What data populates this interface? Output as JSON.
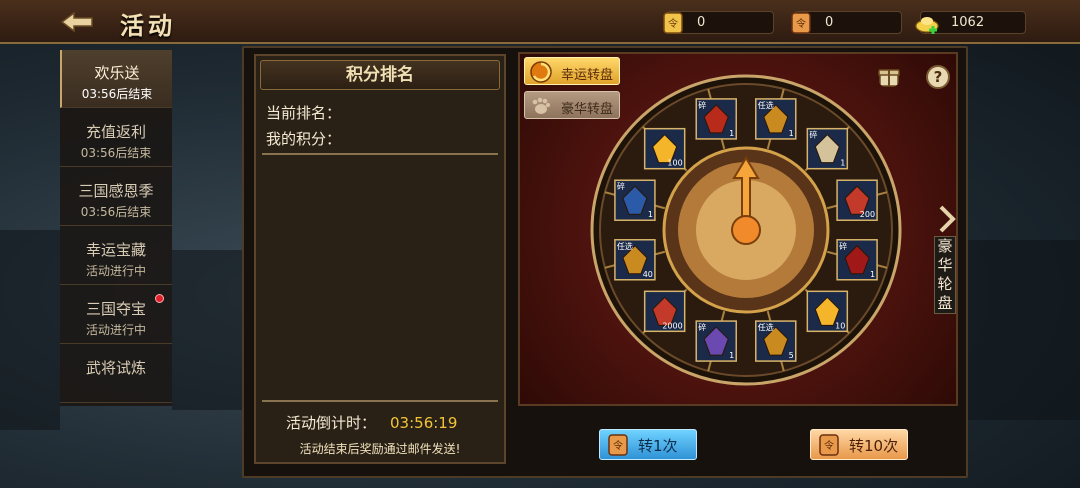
{
  "header": {
    "title": "活动",
    "resources": [
      {
        "icon": "gold-token-icon",
        "value": "0"
      },
      {
        "icon": "bronze-token-icon",
        "value": "0"
      },
      {
        "icon": "ingot-add-icon",
        "value": "1062"
      }
    ]
  },
  "sidebar": {
    "items": [
      {
        "name": "欢乐送",
        "status": "03:56后结束",
        "active": true
      },
      {
        "name": "充值返利",
        "status": "03:56后结束"
      },
      {
        "name": "三国感恩季",
        "status": "03:56后结束"
      },
      {
        "name": "幸运宝藏",
        "status": "活动进行中"
      },
      {
        "name": "三国夺宝",
        "status": "活动进行中",
        "badge": "red-dot"
      },
      {
        "name": "武将试炼",
        "status": ""
      }
    ]
  },
  "rank_panel": {
    "title": "积分排名",
    "current_rank_label": "当前排名：",
    "my_score_label": "我的积分：",
    "countdown_label": "活动倒计时：",
    "countdown_value": "03:56:19",
    "mail_note": "活动结束后奖励通过邮件发送!"
  },
  "wheel": {
    "tabs": [
      {
        "label": "幸运转盘",
        "active": true
      },
      {
        "label": "豪华转盘",
        "active": false
      }
    ],
    "side_tab_label": "豪华轮盘",
    "tag_fragment": "碎",
    "choose_tag": "任选",
    "items": [
      {
        "name": "red-general-fragment",
        "count": "1",
        "tag": "碎",
        "color": "#b82a1a"
      },
      {
        "name": "gold-chest-optional",
        "count": "1",
        "tag": "任选",
        "color": "#c98a1f"
      },
      {
        "name": "white-general-fragment",
        "count": "1",
        "tag": "碎",
        "color": "#d4c29a"
      },
      {
        "name": "wei-package",
        "count": "200",
        "tag": "",
        "color": "#c43a2a"
      },
      {
        "name": "general-fragment-red-banner",
        "count": "1",
        "tag": "碎",
        "color": "#a01818"
      },
      {
        "name": "yellow-crystal",
        "count": "10",
        "tag": "",
        "color": "#f5b52a"
      },
      {
        "name": "gold-chest-optional",
        "count": "5",
        "tag": "任选",
        "color": "#c98a1f"
      },
      {
        "name": "purple-spirit-fragment",
        "count": "1",
        "tag": "碎",
        "color": "#6a4ab0"
      },
      {
        "name": "wei-package",
        "count": "2000",
        "tag": "",
        "color": "#c43a2a"
      },
      {
        "name": "gold-chest-optional",
        "count": "40",
        "tag": "任选",
        "color": "#c98a1f"
      },
      {
        "name": "blue-general-fragment",
        "count": "1",
        "tag": "碎",
        "color": "#2a5aa8"
      },
      {
        "name": "yellow-crystal",
        "count": "100",
        "tag": "",
        "color": "#f5b52a"
      }
    ]
  },
  "buttons": {
    "spin_once": "转1次",
    "spin_ten": "转10次"
  },
  "colors": {
    "accent_gold": "#f3c43a",
    "wheel_red": "#6b1c15",
    "spin_once_blue": "#2f92d6",
    "spin_ten_orange": "#e8984a"
  }
}
